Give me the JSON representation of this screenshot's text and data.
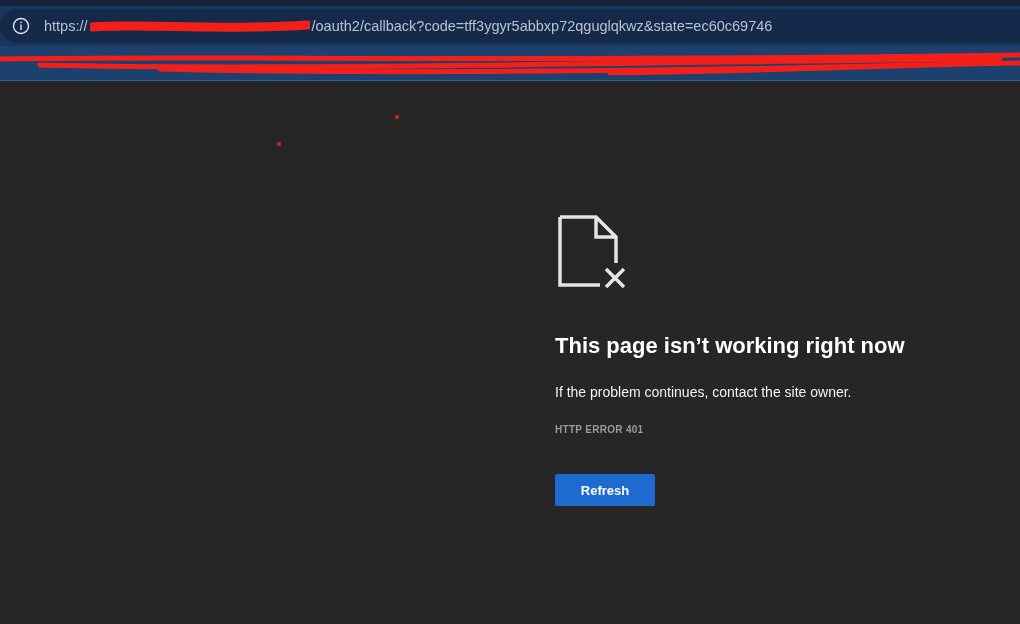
{
  "address_bar": {
    "url_start": "https://",
    "url_end": "/oauth2/callback?code=tff3ygyr5abbxp72qguglqkwz&state=ec60c69746"
  },
  "error_page": {
    "title": "This page isn’t working right now",
    "message": "If the problem continues, contact the site owner.",
    "code": "HTTP ERROR 401",
    "button": "Refresh"
  }
}
